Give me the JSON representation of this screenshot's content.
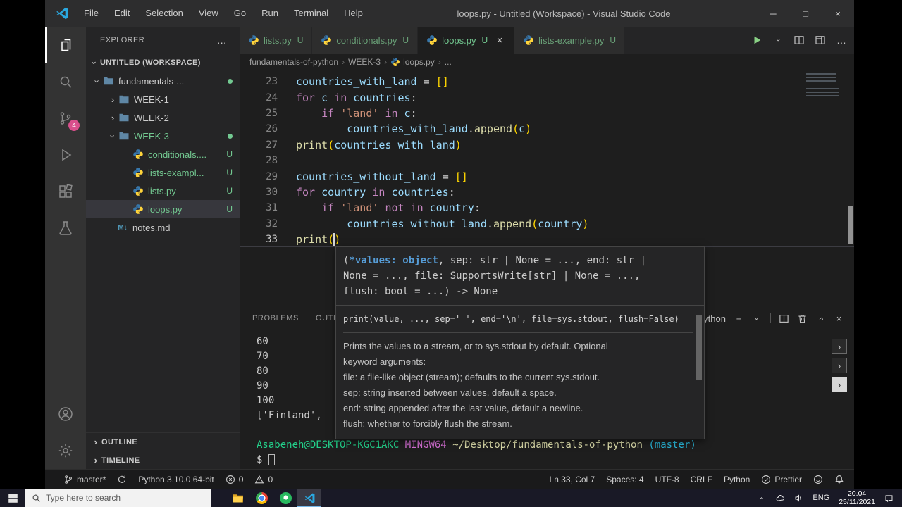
{
  "colors": {
    "accent_blue": "#2aa8e0",
    "badge_pink": "#d94f8c",
    "untracked_green": "#73c991",
    "keyword": "#c586c0",
    "string": "#ce9178",
    "function": "#dcdcaa",
    "variable": "#9cdcfe",
    "bracket_gold": "#ffd700",
    "terminal_green": "#23d18b",
    "terminal_magenta": "#d670d6",
    "terminal_yellow": "#dcdcaa",
    "terminal_cyan": "#29b8db"
  },
  "titlebar": {
    "title": "loops.py - Untitled (Workspace) - Visual Studio Code",
    "menus": [
      "File",
      "Edit",
      "Selection",
      "View",
      "Go",
      "Run",
      "Terminal",
      "Help"
    ]
  },
  "activity_bar": {
    "items": [
      {
        "icon": "files-icon",
        "active": true
      },
      {
        "icon": "search-icon"
      },
      {
        "icon": "source-control-icon",
        "badge": "4"
      },
      {
        "icon": "run-debug-icon"
      },
      {
        "icon": "extensions-icon"
      },
      {
        "icon": "testing-icon"
      }
    ],
    "bottom": [
      {
        "icon": "account-icon"
      },
      {
        "icon": "settings-icon"
      }
    ]
  },
  "sidebar": {
    "header": "EXPLORER",
    "section": "UNTITLED (WORKSPACE)",
    "tree": [
      {
        "label": "fundamentals-...",
        "kind": "folder",
        "depth": 0,
        "expanded": true,
        "dot": true
      },
      {
        "label": "WEEK-1",
        "kind": "folder",
        "depth": 1
      },
      {
        "label": "WEEK-2",
        "kind": "folder",
        "depth": 1
      },
      {
        "label": "WEEK-3",
        "kind": "folder",
        "depth": 1,
        "expanded": true,
        "green": true,
        "dot": true
      },
      {
        "label": "conditionals....",
        "kind": "python",
        "depth": 2,
        "badge": "U",
        "green": true
      },
      {
        "label": "lists-exampl...",
        "kind": "python",
        "depth": 2,
        "badge": "U",
        "green": true
      },
      {
        "label": "lists.py",
        "kind": "python",
        "depth": 2,
        "badge": "U",
        "green": true
      },
      {
        "label": "loops.py",
        "kind": "python",
        "depth": 2,
        "badge": "U",
        "green": true,
        "selected": true
      },
      {
        "label": "notes.md",
        "kind": "markdown",
        "depth": 1
      }
    ],
    "bottom_sections": [
      "OUTLINE",
      "TIMELINE"
    ]
  },
  "tabs": [
    {
      "label": "lists.py",
      "badge": "U"
    },
    {
      "label": "conditionals.py",
      "badge": "U"
    },
    {
      "label": "loops.py",
      "badge": "U",
      "active": true
    },
    {
      "label": "lists-example.py",
      "badge": "U"
    }
  ],
  "editor_actions": [
    "run-icon",
    "chevron-down-icon",
    "split-editor-icon",
    "layout-icon",
    "more-actions-icon"
  ],
  "breadcrumb": [
    {
      "label": "fundamentals-of-python"
    },
    {
      "label": "WEEK-3"
    },
    {
      "label": "loops.py",
      "icon": "python-icon"
    },
    {
      "label": "..."
    }
  ],
  "code": {
    "lines": [
      {
        "n": 23,
        "t": [
          [
            "v",
            "countries_with_land"
          ],
          [
            "p",
            " = "
          ],
          [
            "b",
            "[]"
          ]
        ]
      },
      {
        "n": 24,
        "t": [
          [
            "k",
            "for"
          ],
          [
            "p",
            " "
          ],
          [
            "v",
            "c"
          ],
          [
            "p",
            " "
          ],
          [
            "k",
            "in"
          ],
          [
            "p",
            " "
          ],
          [
            "v",
            "countries"
          ],
          [
            "p",
            ":"
          ]
        ]
      },
      {
        "n": 25,
        "t": [
          [
            "p",
            "    "
          ],
          [
            "k",
            "if"
          ],
          [
            "p",
            " "
          ],
          [
            "s",
            "'land'"
          ],
          [
            "p",
            " "
          ],
          [
            "k",
            "in"
          ],
          [
            "p",
            " "
          ],
          [
            "v",
            "c"
          ],
          [
            "p",
            ":"
          ]
        ]
      },
      {
        "n": 26,
        "t": [
          [
            "p",
            "        "
          ],
          [
            "v",
            "countries_with_land"
          ],
          [
            "p",
            "."
          ],
          [
            "f",
            "append"
          ],
          [
            "b",
            "("
          ],
          [
            "v",
            "c"
          ],
          [
            "b",
            ")"
          ]
        ]
      },
      {
        "n": 27,
        "t": [
          [
            "f",
            "print"
          ],
          [
            "b",
            "("
          ],
          [
            "v",
            "countries_with_land"
          ],
          [
            "b",
            ")"
          ]
        ]
      },
      {
        "n": 28,
        "t": []
      },
      {
        "n": 29,
        "t": [
          [
            "v",
            "countries_without_land"
          ],
          [
            "p",
            " = "
          ],
          [
            "b",
            "[]"
          ]
        ]
      },
      {
        "n": 30,
        "t": [
          [
            "k",
            "for"
          ],
          [
            "p",
            " "
          ],
          [
            "v",
            "country"
          ],
          [
            "p",
            " "
          ],
          [
            "k",
            "in"
          ],
          [
            "p",
            " "
          ],
          [
            "v",
            "countries"
          ],
          [
            "p",
            ":"
          ]
        ]
      },
      {
        "n": 31,
        "t": [
          [
            "p",
            "    "
          ],
          [
            "k",
            "if"
          ],
          [
            "p",
            " "
          ],
          [
            "s",
            "'land'"
          ],
          [
            "p",
            " "
          ],
          [
            "k",
            "not"
          ],
          [
            "p",
            " "
          ],
          [
            "k",
            "in"
          ],
          [
            "p",
            " "
          ],
          [
            "v",
            "country"
          ],
          [
            "p",
            ":"
          ]
        ]
      },
      {
        "n": 32,
        "t": [
          [
            "p",
            "        "
          ],
          [
            "v",
            "countries_without_land"
          ],
          [
            "p",
            "."
          ],
          [
            "f",
            "append"
          ],
          [
            "b",
            "("
          ],
          [
            "v",
            "country"
          ],
          [
            "b",
            ")"
          ]
        ]
      },
      {
        "n": 33,
        "t": [
          [
            "f",
            "print"
          ],
          [
            "b",
            "("
          ],
          [
            "cur",
            ""
          ],
          [
            "b",
            ")"
          ]
        ],
        "current": true
      }
    ],
    "cursor": {
      "line": 33,
      "col": 7
    }
  },
  "popup": {
    "signature": [
      [
        [
          "p",
          "("
        ],
        [
          "hl",
          "*values: object"
        ],
        [
          "p",
          ", sep: str | None = ..., end: str |"
        ]
      ],
      [
        [
          "p",
          "None = ..., file: SupportsWrite[str] | None = ...,"
        ]
      ],
      [
        [
          "p",
          "flush: bool = ...) -> None"
        ]
      ]
    ],
    "doc_code": "print(value, ..., sep=' ', end='\\n', file=sys.stdout, flush=False)",
    "doc_lines": [
      "Prints the values to a stream, or to sys.stdout by default. Optional",
      "keyword arguments:",
      "file: a file-like object (stream); defaults to the current sys.stdout.",
      "sep: string inserted between values, default a space.",
      "end: string appended after the last value, default a newline.",
      "flush: whether to forcibly flush the stream."
    ]
  },
  "panel": {
    "tabs": [
      {
        "label": "PROBLEMS"
      },
      {
        "label": "OUTPUT"
      }
    ],
    "profile": "Python",
    "buttons": [
      "add-icon",
      "chevron-down-icon",
      "|",
      "split-editor-icon",
      "trash-icon",
      "chevron-up-icon",
      "close-icon"
    ],
    "nav_buttons": [
      {},
      {},
      {
        "active": true
      }
    ],
    "terminal": [
      [
        [
          "w",
          "60"
        ]
      ],
      [
        [
          "w",
          "70"
        ]
      ],
      [
        [
          "w",
          "80"
        ]
      ],
      [
        [
          "w",
          "90"
        ]
      ],
      [
        [
          "w",
          "100"
        ]
      ],
      [
        [
          "w",
          "['Finland',"
        ]
      ],
      [],
      [
        [
          "g",
          "Asabeneh@DESKTOP-KGC1AKC"
        ],
        [
          "w",
          " "
        ],
        [
          "m",
          "MINGW64"
        ],
        [
          "w",
          " "
        ],
        [
          "y",
          "~/Desktop/fundamentals-of-python"
        ],
        [
          "w",
          " "
        ],
        [
          "c",
          "(master)"
        ]
      ],
      [
        [
          "w",
          "$ "
        ],
        [
          "cur",
          ""
        ]
      ]
    ]
  },
  "status_bar": {
    "left": [
      {
        "icon": "git-branch-icon",
        "label": "master*"
      },
      {
        "icon": "sync-icon"
      },
      {
        "label": "Python 3.10.0 64-bit"
      },
      {
        "icon": "error-icon",
        "label": "0"
      },
      {
        "icon": "warning-icon",
        "label": "0"
      }
    ],
    "right": [
      {
        "label": "Ln 33, Col 7"
      },
      {
        "label": "Spaces: 4"
      },
      {
        "label": "UTF-8"
      },
      {
        "label": "CRLF"
      },
      {
        "label": "Python"
      },
      {
        "icon": "prettier-check-icon",
        "label": "Prettier"
      },
      {
        "icon": "feedback-smiley-icon"
      },
      {
        "icon": "bell-icon"
      }
    ]
  },
  "taskbar": {
    "search_placeholder": "Type here to search",
    "apps": [
      {
        "icon": "file-explorer-icon"
      },
      {
        "icon": "chrome-icon"
      },
      {
        "icon": "app-green-icon"
      },
      {
        "icon": "vscode-icon",
        "active": true
      }
    ],
    "tray": {
      "icons": [
        "chevron-up-icon",
        "cloud-icon",
        "speaker-icon"
      ],
      "lang": "ENG",
      "time": "20.04",
      "date": "25/11/2021"
    }
  }
}
